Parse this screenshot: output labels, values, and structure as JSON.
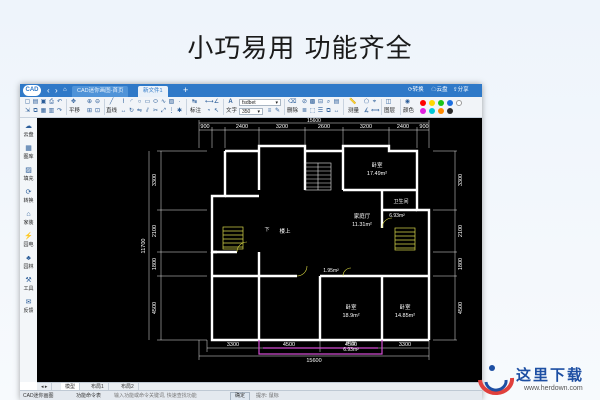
{
  "headline": "小巧易用  功能齐全",
  "titlebar": {
    "logo": "CAD",
    "tabs": [
      {
        "label": "CAD迷你画图-首页",
        "active": false
      },
      {
        "label": "新文件1",
        "active": true
      }
    ],
    "add_tab": "+",
    "right_items": [
      "转换",
      "云盘",
      "分享",
      "账户"
    ],
    "window_controls": [
      "—",
      "□",
      "✕"
    ]
  },
  "ribbon": {
    "left_labels": [
      "平移",
      "直线",
      "标注",
      "文字",
      "删除",
      "测量",
      "图层",
      "颜色"
    ],
    "font_name": "fsdbet",
    "font_size": "350",
    "swatch_colors": [
      "#ff0000",
      "#ffd800",
      "#18c418",
      "#1c6fe0",
      "#ffffff",
      "#e020e0",
      "#00c8d8",
      "#ff8a00",
      "#2b2b2b"
    ]
  },
  "sidebar": {
    "items": [
      {
        "label": "云盘",
        "icon": "cloud-icon"
      },
      {
        "label": "图库",
        "icon": "library-icon"
      },
      {
        "label": "填充",
        "icon": "fill-icon"
      },
      {
        "label": "转换",
        "icon": "convert-icon"
      },
      {
        "label": "家装",
        "icon": "home-icon"
      },
      {
        "label": "园电",
        "icon": "circuit-icon"
      },
      {
        "label": "园林",
        "icon": "tree-icon"
      },
      {
        "label": "工具",
        "icon": "tool-icon"
      },
      {
        "label": "反馈",
        "icon": "feedback-icon"
      }
    ]
  },
  "drawing": {
    "dim_top_total": "15600",
    "dim_top": [
      "900",
      "2400",
      "3200",
      "2600",
      "3200",
      "2400",
      "900"
    ],
    "dim_bottom": [
      "3300",
      "4500",
      "4500",
      "3300"
    ],
    "dim_bottom_total": "15600",
    "dim_left": [
      "3300",
      "2100",
      "1800",
      "4500"
    ],
    "dim_left_total": "11700",
    "dim_right": [
      "3300",
      "2100",
      "1800",
      "4500"
    ],
    "rooms": [
      {
        "name": "卧室",
        "area": "17.49m²"
      },
      {
        "name": "卫生间",
        "area": ""
      },
      {
        "name": "家庭厅",
        "area": "11.31m²"
      },
      {
        "name": "",
        "area": "6.93m²"
      },
      {
        "name": "楼上",
        "area": ""
      },
      {
        "name": "下",
        "area": ""
      },
      {
        "name": "",
        "area": "1.95m²"
      },
      {
        "name": "卧室",
        "area": "18.9m²"
      },
      {
        "name": "卧室",
        "area": "14.85m²"
      },
      {
        "name": "阳台",
        "area": "6.93m²"
      }
    ]
  },
  "bottom_tabs": [
    "模型",
    "布局1",
    "布局2"
  ],
  "status": {
    "logo": "CAD迷你画图",
    "command_label": "功能命令表",
    "prompt": "输入功能或命令关键词, 快速查找功能",
    "confirm": "确定",
    "hint": "提示: 鼠标"
  },
  "watermark": {
    "text": "这里下载",
    "url": "www.herdown.com"
  }
}
